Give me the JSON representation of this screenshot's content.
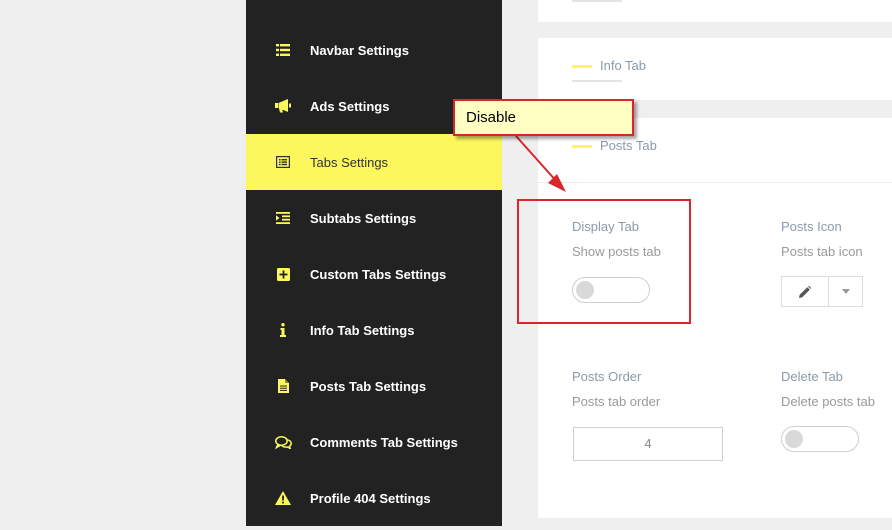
{
  "sidebar": {
    "items": [
      {
        "label": "Navbar Settings",
        "icon": "list-icon",
        "active": false
      },
      {
        "label": "Ads Settings",
        "icon": "megaphone-icon",
        "active": false
      },
      {
        "label": "Tabs Settings",
        "icon": "list-alt-icon",
        "active": true
      },
      {
        "label": "Subtabs Settings",
        "icon": "indent-icon",
        "active": false
      },
      {
        "label": "Custom Tabs Settings",
        "icon": "plus-square-icon",
        "active": false
      },
      {
        "label": "Info Tab Settings",
        "icon": "info-icon",
        "active": false
      },
      {
        "label": "Posts Tab Settings",
        "icon": "file-icon",
        "active": false
      },
      {
        "label": "Comments Tab Settings",
        "icon": "comments-icon",
        "active": false
      },
      {
        "label": "Profile 404 Settings",
        "icon": "warning-icon",
        "active": false
      }
    ]
  },
  "main": {
    "info_tab": {
      "title": "Info Tab"
    },
    "posts_tab": {
      "title": "Posts Tab",
      "display_tab": {
        "title": "Display Tab",
        "desc": "Show posts tab",
        "enabled": false
      },
      "posts_icon": {
        "title": "Posts Icon",
        "desc": "Posts tab icon",
        "icon": "pencil-icon"
      },
      "posts_order": {
        "title": "Posts Order",
        "desc": "Posts tab order",
        "value": "4"
      },
      "delete_tab": {
        "title": "Delete Tab",
        "desc": "Delete posts tab",
        "enabled": false
      }
    }
  },
  "annotation": {
    "callout_text": "Disable",
    "color": "#d8262c",
    "callout_bg": "#ffffc4"
  },
  "colors": {
    "accent": "#fbf75c",
    "sidebar_bg": "#222222"
  }
}
